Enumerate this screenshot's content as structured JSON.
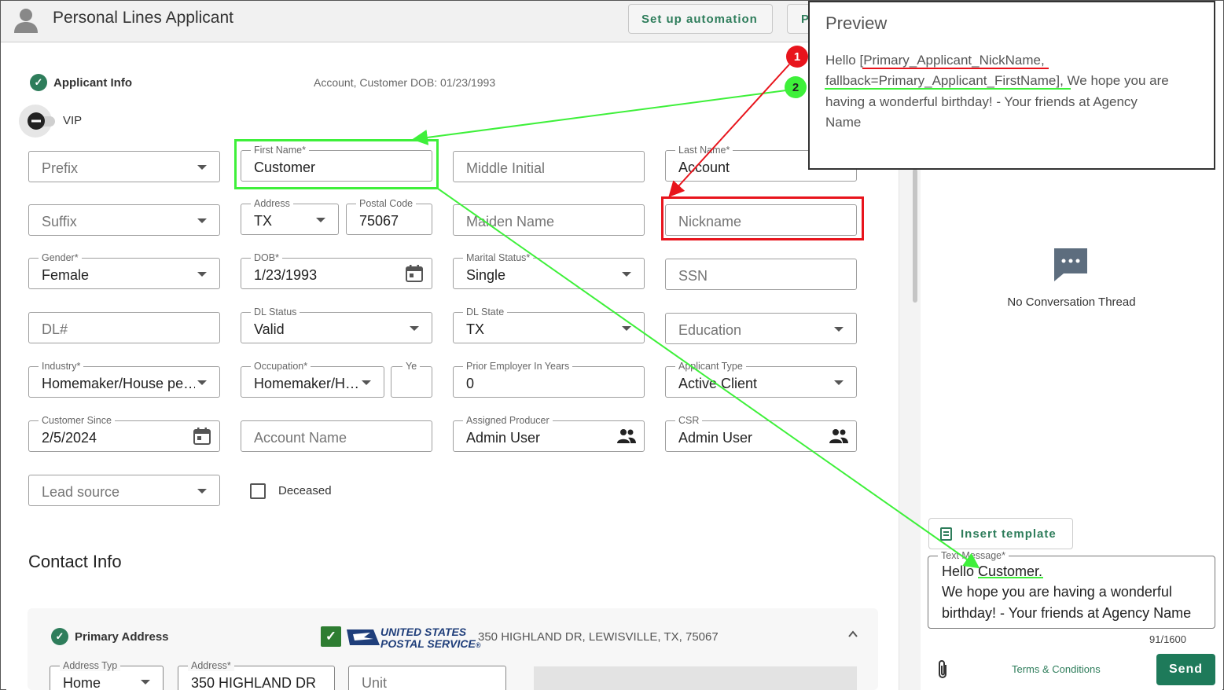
{
  "header": {
    "title": "Personal Lines Applicant",
    "automation_button": "Set up automation",
    "second_button_partial": "P"
  },
  "applicant": {
    "section_title": "Applicant Info",
    "meta": "Account, Customer  DOB: 01/23/1993",
    "vip_label": "VIP"
  },
  "fields": {
    "prefix": {
      "placeholder": "Prefix"
    },
    "first_name": {
      "label": "First Name*",
      "value": "Customer"
    },
    "middle_initial": {
      "placeholder": "Middle Initial"
    },
    "last_name": {
      "label": "Last Name*",
      "value": "Account"
    },
    "suffix": {
      "placeholder": "Suffix"
    },
    "address_state": {
      "label": "Address",
      "value": "TX"
    },
    "postal_code": {
      "label": "Postal Code",
      "value": "75067"
    },
    "maiden_name": {
      "placeholder": "Maiden Name"
    },
    "nickname": {
      "placeholder": "Nickname"
    },
    "gender": {
      "label": "Gender*",
      "value": "Female"
    },
    "dob": {
      "label": "DOB*",
      "value": "1/23/1993"
    },
    "marital_status": {
      "label": "Marital Status*",
      "value": "Single"
    },
    "ssn": {
      "placeholder": "SSN"
    },
    "dl_number": {
      "placeholder": "DL#"
    },
    "dl_status": {
      "label": "DL Status",
      "value": "Valid"
    },
    "dl_state": {
      "label": "DL State",
      "value": "TX"
    },
    "education": {
      "placeholder": "Education"
    },
    "industry": {
      "label": "Industry*",
      "value": "Homemaker/House pe…"
    },
    "occupation": {
      "label": "Occupation*",
      "value": "Homemaker/H…"
    },
    "years": {
      "label": "Ye"
    },
    "prior_employer": {
      "label": "Prior Employer In Years",
      "value": "0"
    },
    "applicant_type": {
      "label": "Applicant Type",
      "value": "Active Client"
    },
    "customer_since": {
      "label": "Customer Since",
      "value": "2/5/2024"
    },
    "account_name": {
      "placeholder": "Account Name"
    },
    "assigned_producer": {
      "label": "Assigned Producer",
      "value": "Admin User"
    },
    "csr": {
      "label": "CSR",
      "value": "Admin User"
    },
    "lead_source": {
      "placeholder": "Lead source"
    },
    "deceased_label": "Deceased"
  },
  "contact": {
    "title": "Contact Info",
    "primary_address_title": "Primary Address",
    "usps_line1": "UNITED STATES",
    "usps_line2": "POSTAL SERVICE",
    "usps_mark": "®",
    "address_full": "350 HIGHLAND DR, LEWISVILLE, TX, 75067",
    "address_type": {
      "label": "Address Typ",
      "value": "Home"
    },
    "address": {
      "label": "Address*",
      "value": "350 HIGHLAND DR"
    },
    "unit": {
      "placeholder": "Unit"
    }
  },
  "messaging": {
    "no_thread": "No Conversation Thread",
    "insert_template": "Insert template",
    "text_label": "Text Message*",
    "msg_line1": "Hello Customer.",
    "msg_line2": "We hope you are having a wonderful",
    "msg_line3": "birthday! - Your friends at Agency Name",
    "counter": "91/1600",
    "terms": "Terms & Conditions",
    "send": "Send"
  },
  "preview": {
    "title": "Preview",
    "line1_prefix": "Hello ",
    "line1_token": "[Primary_Applicant_NickName",
    "line1_suffix": ",",
    "line2_token": "fallback=Primary_Applicant_FirstName",
    "line2_suffix": "], We hope you are",
    "line3": "having a wonderful birthday! - Your friends at Agency",
    "line4": "Name"
  },
  "annotations": {
    "badge1": "1",
    "badge2": "2",
    "red": "#e8141c",
    "green": "#3ef03a"
  },
  "colors": {
    "accent": "#2e7d5b",
    "send_bg": "#1e7a5a"
  }
}
